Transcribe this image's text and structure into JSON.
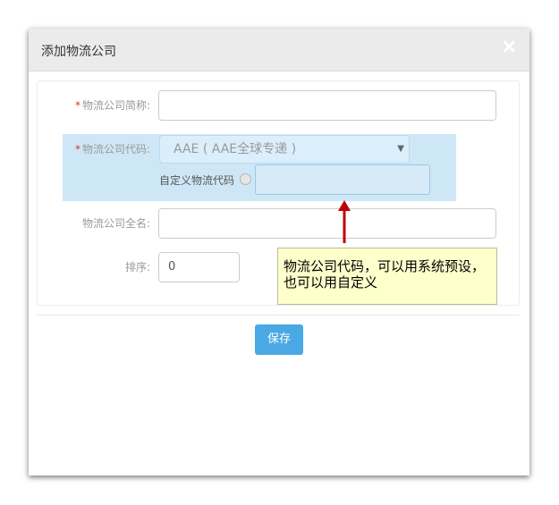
{
  "dialog": {
    "title": "添加物流公司",
    "close_icon": "×"
  },
  "form": {
    "short_name": {
      "label": "物流公司简称:",
      "required": "*",
      "value": ""
    },
    "code": {
      "label": "物流公司代码:",
      "required": "*",
      "selected": "AAE ( AAE全球专递 )",
      "custom_label": "自定义物流代码",
      "custom_value": ""
    },
    "full_name": {
      "label": "物流公司全名:",
      "value": ""
    },
    "sort": {
      "label": "排序:",
      "value": "0"
    }
  },
  "save_label": "保存",
  "annotation": {
    "text": "物流公司代码，可以用系统预设，也可以用自定义",
    "arrow_color": "#c00000"
  },
  "colors": {
    "accent": "#4aa9e4",
    "required": "#e0312b",
    "highlight": "#c5e3f6",
    "note_bg": "#ffffcc"
  }
}
